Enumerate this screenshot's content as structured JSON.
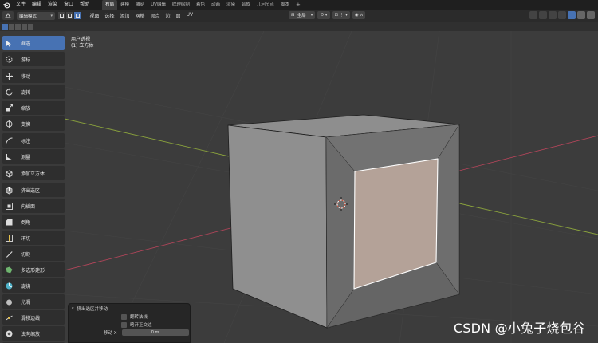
{
  "menubar": {
    "items": [
      "文件",
      "编辑",
      "渲染",
      "窗口",
      "帮助"
    ],
    "workspace_tabs": [
      "布局",
      "建模",
      "雕刻",
      "UV编辑",
      "纹理绘制",
      "着色",
      "动画",
      "渲染",
      "合成",
      "几何节点",
      "脚本"
    ],
    "active_tab": "布局",
    "add_tab": "+"
  },
  "header": {
    "mode": "编辑模式",
    "menus": [
      "视图",
      "选择",
      "添加",
      "网格",
      "顶点",
      "边",
      "面",
      "UV"
    ],
    "transform_orientation": "全局"
  },
  "toolbar": {
    "tools": [
      {
        "label": "框选",
        "icon": "select-box-icon",
        "active": true
      },
      {
        "label": "游标",
        "icon": "cursor-icon"
      },
      {
        "label": "移动",
        "icon": "move-icon",
        "gap": true
      },
      {
        "label": "旋转",
        "icon": "rotate-icon"
      },
      {
        "label": "缩放",
        "icon": "scale-icon"
      },
      {
        "label": "变换",
        "icon": "transform-icon"
      },
      {
        "label": "标注",
        "icon": "annotate-icon",
        "gap": true
      },
      {
        "label": "测量",
        "icon": "measure-icon"
      },
      {
        "label": "添加立方体",
        "icon": "add-cube-icon",
        "gap": true
      },
      {
        "label": "挤出选区",
        "icon": "extrude-icon",
        "gap": true
      },
      {
        "label": "内插面",
        "icon": "inset-icon"
      },
      {
        "label": "倒角",
        "icon": "bevel-icon"
      },
      {
        "label": "环切",
        "icon": "loop-cut-icon"
      },
      {
        "label": "切割",
        "icon": "knife-icon"
      },
      {
        "label": "多边形建形",
        "icon": "poly-build-icon"
      },
      {
        "label": "旋绕",
        "icon": "spin-icon"
      },
      {
        "label": "光滑",
        "icon": "smooth-icon"
      },
      {
        "label": "滑移边线",
        "icon": "edge-slide-icon"
      },
      {
        "label": "法向缩放",
        "icon": "shrink-fatten-icon"
      },
      {
        "label": "切变",
        "icon": "shear-icon"
      }
    ]
  },
  "viewport": {
    "view_name": "用户透视",
    "object_name": "(1) 立方体"
  },
  "operator_panel": {
    "title": "挤出选区并移动",
    "options": [
      "翻转法线",
      "略开正交边"
    ],
    "field_label": "移动 X",
    "field_value": "0 m"
  },
  "watermark": "CSDN @小兔子烧包谷",
  "colors": {
    "accent": "#4772b3",
    "selected_face": "#b4a298",
    "axis_x": "#b3455a",
    "axis_y": "#8aa23c"
  }
}
